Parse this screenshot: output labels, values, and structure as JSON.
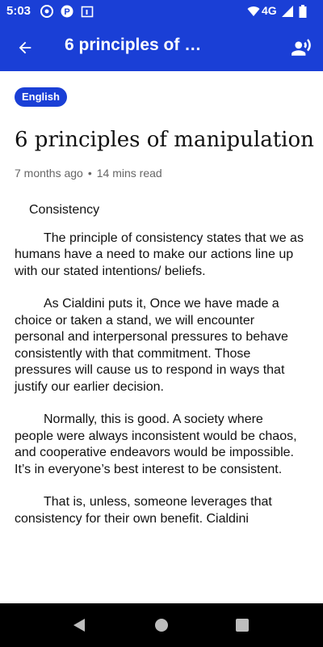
{
  "status_bar": {
    "time": "5:03",
    "network": "4G",
    "icons": [
      "chrome-icon",
      "p-icon",
      "calendar-icon",
      "wifi-icon",
      "signal-icon",
      "battery-icon"
    ]
  },
  "app_bar": {
    "title": "6 principles of …",
    "colors": {
      "primary": "#1a3fd6"
    }
  },
  "article": {
    "language": "English",
    "title": "6 principles of manipulation",
    "posted": "7 months ago",
    "read_time": "14 mins read",
    "section_heading": "Consistency",
    "paragraphs": [
      "The principle of consistency states that we as humans have a need to make our actions line up with our stated intentions/ beliefs.",
      "As Cialdini puts it, Once we have made a choice or taken a stand, we will encounter personal and interpersonal pressures to behave consistently with that commitment. Those pressures will cause us to respond in ways that justify our earlier decision.",
      "Normally, this is good. A society where people were always inconsistent would be chaos, and cooperative endeavors would be impossible. It’s in everyone’s best interest to be consistent.",
      "That is, unless, someone leverages that consistency for their own benefit. Cialdini"
    ]
  },
  "nav_bar": {
    "buttons": [
      "back-nav-icon",
      "home-nav-icon",
      "recents-nav-icon"
    ]
  }
}
